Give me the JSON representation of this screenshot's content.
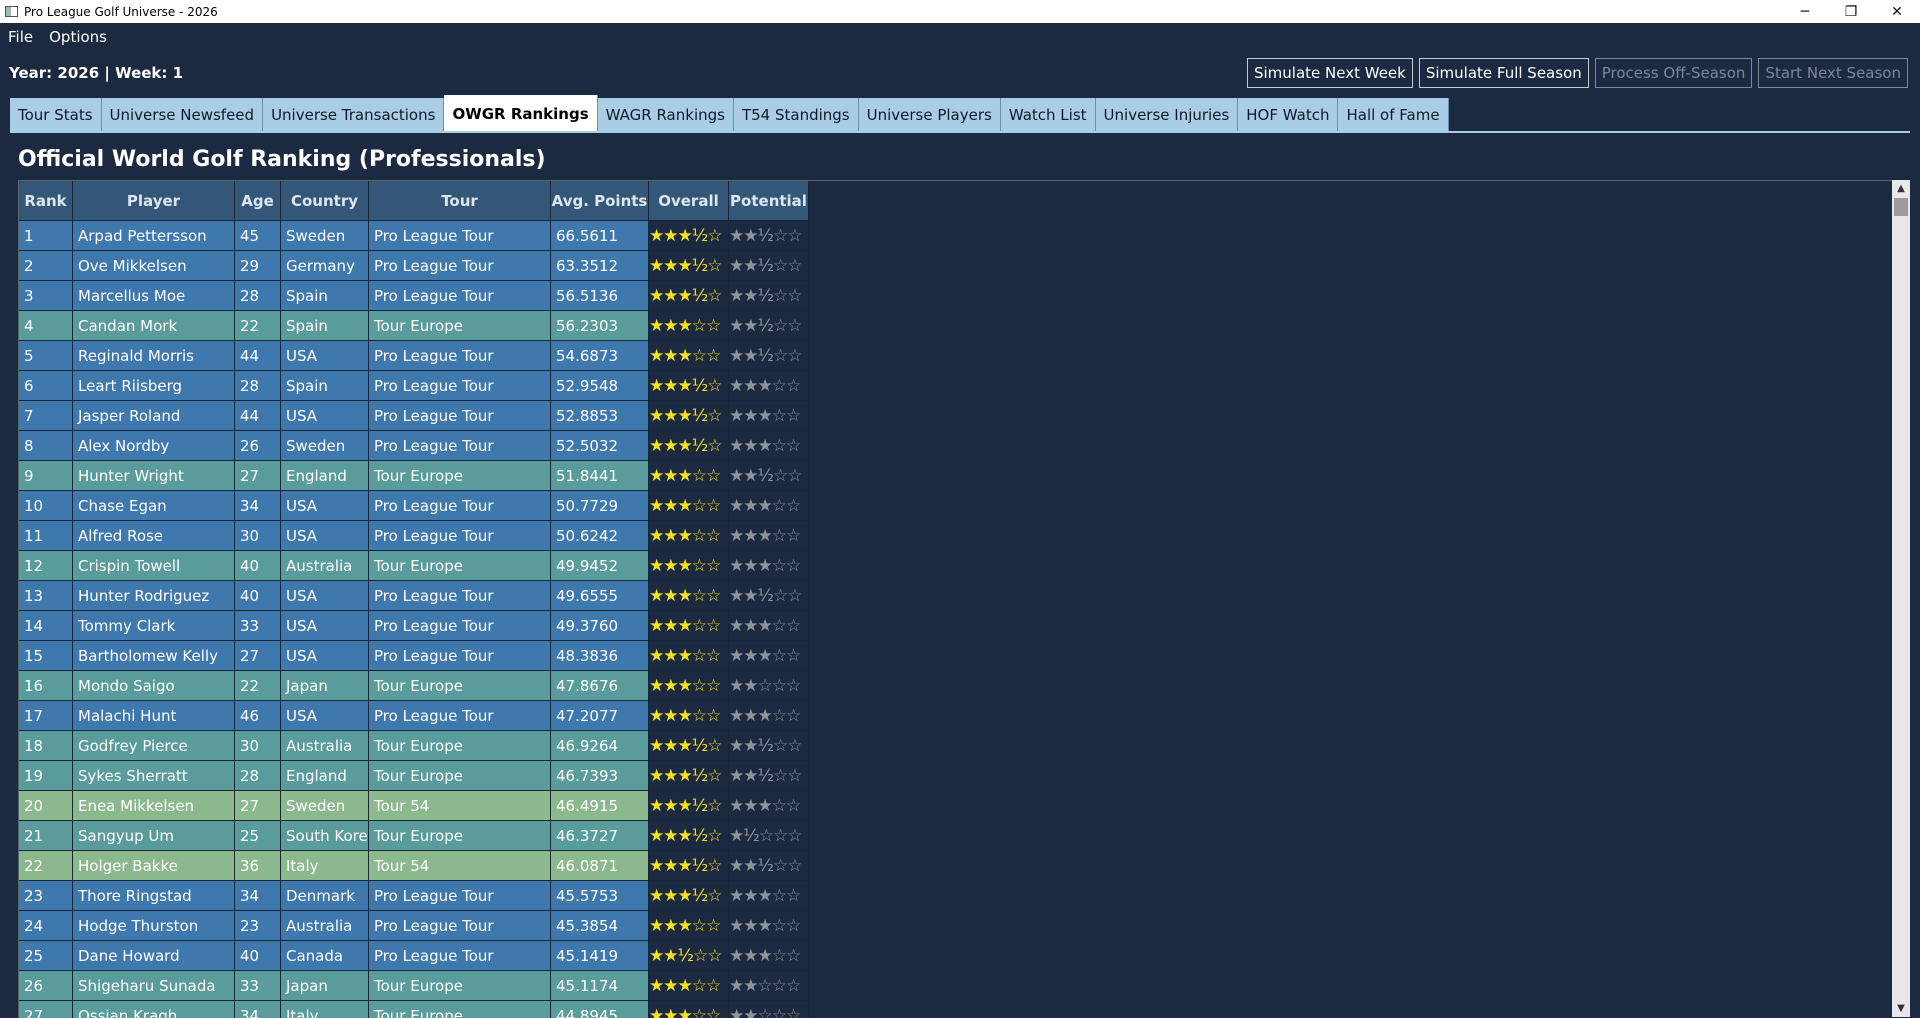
{
  "window": {
    "title": "Pro League Golf Universe - 2026"
  },
  "menu": [
    "File",
    "Options"
  ],
  "header": {
    "year_week": "Year: 2026 | Week: 1"
  },
  "actions": [
    {
      "label": "Simulate Next Week",
      "enabled": true
    },
    {
      "label": "Simulate Full Season",
      "enabled": true
    },
    {
      "label": "Process Off-Season",
      "enabled": false
    },
    {
      "label": "Start Next Season",
      "enabled": false
    }
  ],
  "tabs": [
    {
      "label": "Tour Stats"
    },
    {
      "label": "Universe Newsfeed"
    },
    {
      "label": "Universe Transactions"
    },
    {
      "label": "OWGR Rankings",
      "active": true
    },
    {
      "label": "WAGR Rankings"
    },
    {
      "label": "T54 Standings"
    },
    {
      "label": "Universe Players"
    },
    {
      "label": "Watch List"
    },
    {
      "label": "Universe Injuries"
    },
    {
      "label": "HOF Watch"
    },
    {
      "label": "Hall of Fame"
    }
  ],
  "page_title": "Official World Golf Ranking (Professionals)",
  "table": {
    "columns": [
      "Rank",
      "Player",
      "Age",
      "Country",
      "Tour",
      "Avg. Points",
      "Overall",
      "Potential"
    ],
    "rows": [
      {
        "rank": "1",
        "player": "Arpad Pettersson",
        "age": "45",
        "country": "Sweden",
        "tour": "Pro League Tour",
        "points": "66.5611",
        "overall": "★★★½☆",
        "potential": "★★½☆☆"
      },
      {
        "rank": "2",
        "player": "Ove Mikkelsen",
        "age": "29",
        "country": "Germany",
        "tour": "Pro League Tour",
        "points": "63.3512",
        "overall": "★★★½☆",
        "potential": "★★½☆☆"
      },
      {
        "rank": "3",
        "player": "Marcellus Moe",
        "age": "28",
        "country": "Spain",
        "tour": "Pro League Tour",
        "points": "56.5136",
        "overall": "★★★½☆",
        "potential": "★★½☆☆"
      },
      {
        "rank": "4",
        "player": "Candan Mork",
        "age": "22",
        "country": "Spain",
        "tour": "Tour Europe",
        "points": "56.2303",
        "overall": "★★★☆☆",
        "potential": "★★½☆☆"
      },
      {
        "rank": "5",
        "player": "Reginald Morris",
        "age": "44",
        "country": "USA",
        "tour": "Pro League Tour",
        "points": "54.6873",
        "overall": "★★★☆☆",
        "potential": "★★½☆☆"
      },
      {
        "rank": "6",
        "player": "Leart Riisberg",
        "age": "28",
        "country": "Spain",
        "tour": "Pro League Tour",
        "points": "52.9548",
        "overall": "★★★½☆",
        "potential": "★★★☆☆"
      },
      {
        "rank": "7",
        "player": "Jasper Roland",
        "age": "44",
        "country": "USA",
        "tour": "Pro League Tour",
        "points": "52.8853",
        "overall": "★★★½☆",
        "potential": "★★★☆☆"
      },
      {
        "rank": "8",
        "player": "Alex Nordby",
        "age": "26",
        "country": "Sweden",
        "tour": "Pro League Tour",
        "points": "52.5032",
        "overall": "★★★½☆",
        "potential": "★★★☆☆"
      },
      {
        "rank": "9",
        "player": "Hunter Wright",
        "age": "27",
        "country": "England",
        "tour": "Tour Europe",
        "points": "51.8441",
        "overall": "★★★☆☆",
        "potential": "★★½☆☆"
      },
      {
        "rank": "10",
        "player": "Chase Egan",
        "age": "34",
        "country": "USA",
        "tour": "Pro League Tour",
        "points": "50.7729",
        "overall": "★★★☆☆",
        "potential": "★★★☆☆"
      },
      {
        "rank": "11",
        "player": "Alfred Rose",
        "age": "30",
        "country": "USA",
        "tour": "Pro League Tour",
        "points": "50.6242",
        "overall": "★★★☆☆",
        "potential": "★★★☆☆"
      },
      {
        "rank": "12",
        "player": "Crispin Towell",
        "age": "40",
        "country": "Australia",
        "tour": "Tour Europe",
        "points": "49.9452",
        "overall": "★★★☆☆",
        "potential": "★★★☆☆"
      },
      {
        "rank": "13",
        "player": "Hunter Rodriguez",
        "age": "40",
        "country": "USA",
        "tour": "Pro League Tour",
        "points": "49.6555",
        "overall": "★★★☆☆",
        "potential": "★★½☆☆"
      },
      {
        "rank": "14",
        "player": "Tommy Clark",
        "age": "33",
        "country": "USA",
        "tour": "Pro League Tour",
        "points": "49.3760",
        "overall": "★★★☆☆",
        "potential": "★★★☆☆"
      },
      {
        "rank": "15",
        "player": "Bartholomew Kelly",
        "age": "27",
        "country": "USA",
        "tour": "Pro League Tour",
        "points": "48.3836",
        "overall": "★★★☆☆",
        "potential": "★★★☆☆"
      },
      {
        "rank": "16",
        "player": "Mondo Saigo",
        "age": "22",
        "country": "Japan",
        "tour": "Tour Europe",
        "points": "47.8676",
        "overall": "★★★☆☆",
        "potential": "★★☆☆☆"
      },
      {
        "rank": "17",
        "player": "Malachi Hunt",
        "age": "46",
        "country": "USA",
        "tour": "Pro League Tour",
        "points": "47.2077",
        "overall": "★★★☆☆",
        "potential": "★★★☆☆"
      },
      {
        "rank": "18",
        "player": "Godfrey Pierce",
        "age": "30",
        "country": "Australia",
        "tour": "Tour Europe",
        "points": "46.9264",
        "overall": "★★★½☆",
        "potential": "★★½☆☆"
      },
      {
        "rank": "19",
        "player": "Sykes Sherratt",
        "age": "28",
        "country": "England",
        "tour": "Tour Europe",
        "points": "46.7393",
        "overall": "★★★½☆",
        "potential": "★★½☆☆"
      },
      {
        "rank": "20",
        "player": "Enea Mikkelsen",
        "age": "27",
        "country": "Sweden",
        "tour": "Tour 54",
        "points": "46.4915",
        "overall": "★★★½☆",
        "potential": "★★★☆☆"
      },
      {
        "rank": "21",
        "player": "Sangyup Um",
        "age": "25",
        "country": "South Korea",
        "tour": "Tour Europe",
        "points": "46.3727",
        "overall": "★★★½☆",
        "potential": "★½☆☆☆"
      },
      {
        "rank": "22",
        "player": "Holger Bakke",
        "age": "36",
        "country": "Italy",
        "tour": "Tour 54",
        "points": "46.0871",
        "overall": "★★★½☆",
        "potential": "★★½☆☆"
      },
      {
        "rank": "23",
        "player": "Thore Ringstad",
        "age": "34",
        "country": "Denmark",
        "tour": "Pro League Tour",
        "points": "45.5753",
        "overall": "★★★½☆",
        "potential": "★★★☆☆"
      },
      {
        "rank": "24",
        "player": "Hodge Thurston",
        "age": "23",
        "country": "Australia",
        "tour": "Pro League Tour",
        "points": "45.3854",
        "overall": "★★★☆☆",
        "potential": "★★★☆☆"
      },
      {
        "rank": "25",
        "player": "Dane Howard",
        "age": "40",
        "country": "Canada",
        "tour": "Pro League Tour",
        "points": "45.1419",
        "overall": "★★½☆☆",
        "potential": "★★★☆☆"
      },
      {
        "rank": "26",
        "player": "Shigeharu Sunada",
        "age": "33",
        "country": "Japan",
        "tour": "Tour Europe",
        "points": "45.1174",
        "overall": "★★★☆☆",
        "potential": "★★☆☆☆"
      },
      {
        "rank": "27",
        "player": "Ossian Kragh",
        "age": "34",
        "country": "Italy",
        "tour": "Tour Europe",
        "points": "44.8945",
        "overall": "★★★☆☆",
        "potential": "★★☆☆☆"
      }
    ]
  },
  "colors": {
    "background": "#1b2a41",
    "pro_league_tour": "#3f78ad",
    "tour_europe": "#5a9b9b",
    "tour_54": "#8cb88e",
    "star": "#f5e023",
    "potential_star": "#8f949a"
  }
}
